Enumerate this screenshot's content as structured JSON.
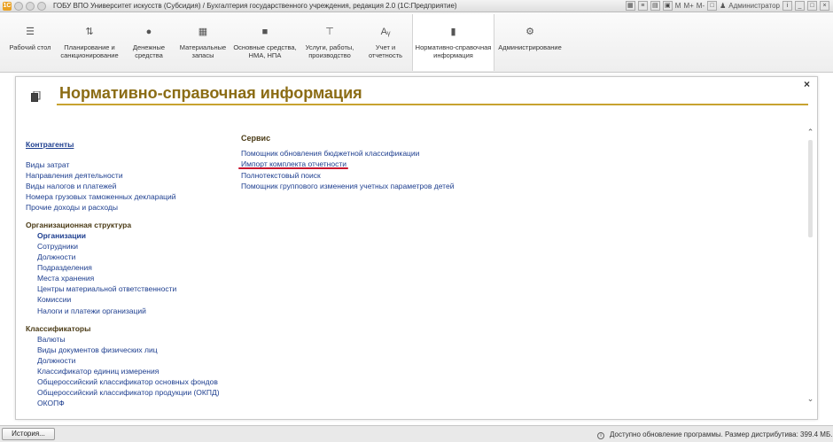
{
  "window": {
    "title": "ГОБУ ВПО Университет искусств (Субсидия) / Бухгалтерия государственного учреждения, редакция 2.0  (1С:Предприятие)",
    "user": "Администратор",
    "mem_labels": [
      "M",
      "M+",
      "M-"
    ]
  },
  "toolbar": {
    "items": [
      {
        "label": "Рабочий стол",
        "icon": "menu-icon"
      },
      {
        "label": "Планирование и санкционирование",
        "icon": "planning-icon"
      },
      {
        "label": "Денежные средства",
        "icon": "money-icon"
      },
      {
        "label": "Материальные запасы",
        "icon": "materials-icon"
      },
      {
        "label": "Основные средства, НМА, НПА",
        "icon": "truck-icon"
      },
      {
        "label": "Услуги, работы, производство",
        "icon": "tools-icon"
      },
      {
        "label": "Учет и отчетность",
        "icon": "accounting-icon"
      },
      {
        "label": "Нормативно-справочная информация",
        "icon": "reference-icon"
      },
      {
        "label": "Администрирование",
        "icon": "gear-icon"
      }
    ]
  },
  "panel": {
    "title": "Нормативно-справочная информация",
    "close": "×"
  },
  "left_column": {
    "counterparties": "Контрагенты",
    "group1": [
      "Виды затрат",
      "Направления деятельности",
      "Виды налогов и платежей",
      "Номера грузовых таможенных деклараций",
      "Прочие доходы и расходы"
    ],
    "org_structure_header": "Организационная структура",
    "org_structure_items": [
      "Организации",
      "Сотрудники",
      "Должности",
      "Подразделения",
      "Места хранения",
      "Центры материальной ответственности",
      "Комиссии",
      "Налоги и платежи организаций"
    ],
    "classifiers_header": "Классификаторы",
    "classifiers_items": [
      "Валюты",
      "Виды документов физических лиц",
      "Должности",
      "Классификатор единиц измерения",
      "Общероссийский классификатор основных фондов",
      "Общероссийский классификатор продукции (ОКПД)",
      "ОКОПФ"
    ]
  },
  "service": {
    "header": "Сервис",
    "items": [
      "Помощник обновления бюджетной классификации",
      "Импорт комплекта отчетности",
      "Полнотекстовый поиск",
      "Помощник группового изменения учетных параметров детей"
    ]
  },
  "statusbar": {
    "history": "История...",
    "info": "Доступно обновление программы. Размер дистрибутива: 399.4 МБ."
  },
  "colors": {
    "title_gold": "#8b6c14",
    "link_blue": "#1d3e8f",
    "red_underline": "#c8102e"
  }
}
